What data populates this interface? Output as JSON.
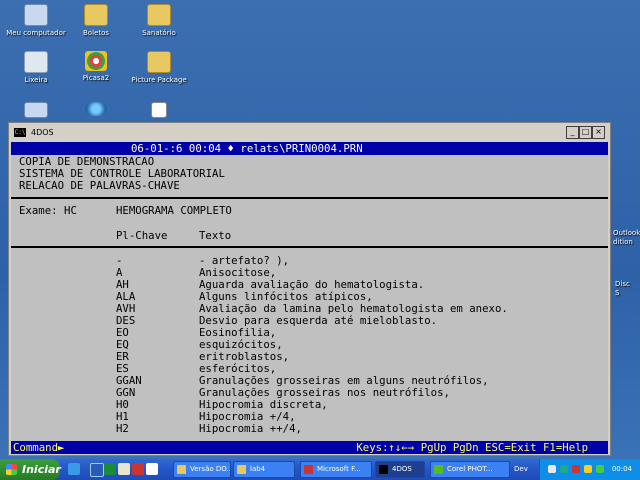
{
  "desktop": {
    "icons": [
      {
        "label": "Meu computador"
      },
      {
        "label": "Boletos"
      },
      {
        "label": "Sanatório"
      },
      {
        "label": "Lixeira"
      },
      {
        "label": "Picasa2"
      },
      {
        "label": "Picture Package"
      }
    ],
    "partial_right": [
      "Outlook",
      "dition",
      "Disc",
      "S"
    ]
  },
  "window": {
    "title": "4DOS",
    "icon_text": "C:\\"
  },
  "console": {
    "header": "06-01-:6 00:04 ♦ relats\\PRIN0004.PRN",
    "title_lines": [
      "COPIA DE DEMONSTRACAO",
      "SISTEMA DE CONTROLE LABORATORIAL",
      "RELACAO DE PALAVRAS-CHAVE"
    ],
    "exam_label": "Exame: HC",
    "exam_name": "HEMOGRAMA COMPLETO",
    "col_key": "Pl-Chave",
    "col_text": "Texto",
    "rows": [
      {
        "key": "-",
        "text": "- artefato? ),"
      },
      {
        "key": "A",
        "text": "Anisocitose,"
      },
      {
        "key": "AH",
        "text": "Aguarda avaliação do hematologista."
      },
      {
        "key": "ALA",
        "text": "Alguns linfócitos atípicos,"
      },
      {
        "key": "AVH",
        "text": "Avaliação da lamina pelo hematologista em anexo."
      },
      {
        "key": "DES",
        "text": "Desvio para esquerda até mieloblasto."
      },
      {
        "key": "EO",
        "text": "Eosinofilia,"
      },
      {
        "key": "EQ",
        "text": "esquizócitos,"
      },
      {
        "key": "ER",
        "text": "eritroblastos,"
      },
      {
        "key": "ES",
        "text": "esferócitos,"
      },
      {
        "key": "GGAN",
        "text": "Granulações grosseiras em alguns neutrófilos,"
      },
      {
        "key": "GGN",
        "text": "Granulações grosseiras nos neutrófilos,"
      },
      {
        "key": "H0",
        "text": "Hipocromia discreta,"
      },
      {
        "key": "H1",
        "text": "Hipocromia +/4,"
      },
      {
        "key": "H2",
        "text": "Hipocromia ++/4,"
      }
    ],
    "command_label": "Command►",
    "keys_hint": "Keys:↑↓←→ PgUp PgDn ESC=Exit F1=Help"
  },
  "taskbar": {
    "start_label": "Iniciar",
    "tasks": [
      {
        "label": "Versão DO..."
      },
      {
        "label": "lab4"
      },
      {
        "label": "Microsoft F..."
      },
      {
        "label": "4DOS"
      },
      {
        "label": "Corel PHOT..."
      }
    ],
    "dev_label": "Dev",
    "clock": "00:04"
  }
}
